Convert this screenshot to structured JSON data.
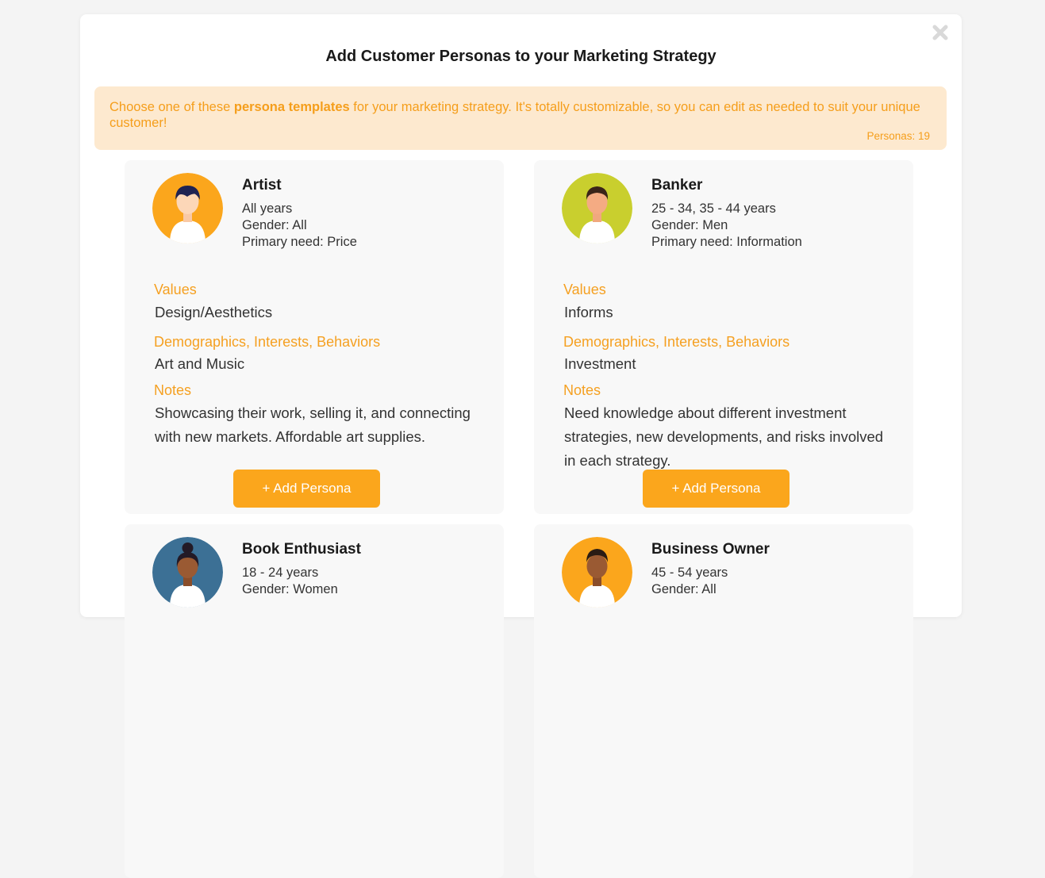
{
  "modal": {
    "title": "Add Customer Personas to your Marketing Strategy",
    "close_icon": "close-icon"
  },
  "notice": {
    "text_before": "Choose one of these ",
    "text_bold": "persona templates",
    "text_after": " for your marketing strategy. It's totally customizable, so you can edit as needed to suit your unique customer!",
    "count_label": "Personas: 19"
  },
  "labels": {
    "values": "Values",
    "demographics": "Demographics, Interests, Behaviors",
    "notes": "Notes",
    "add_button": "+ Add Persona"
  },
  "colors": {
    "accent": "#fba61c",
    "notice_bg": "#fde9cf",
    "avatar_artist": "#fba61c",
    "avatar_banker": "#c9cf2e",
    "avatar_book": "#3c7095",
    "avatar_business": "#fba61c"
  },
  "personas": [
    {
      "name": "Artist",
      "age": "All years",
      "gender": "Gender: All",
      "need": "Primary need: Price",
      "values": "Design/Aesthetics",
      "demographics": "Art and Music",
      "notes": "Showcasing their work, selling it, and connecting with new markets. Affordable art supplies.",
      "icon": "artist-avatar-icon"
    },
    {
      "name": "Banker",
      "age": "25 - 34, 35 - 44 years",
      "gender": "Gender: Men",
      "need": "Primary need: Information",
      "values": "Informs",
      "demographics": "Investment",
      "notes": "Need knowledge about different investment strategies, new developments, and risks involved in each strategy.",
      "icon": "banker-avatar-icon"
    },
    {
      "name": "Book Enthusiast",
      "age": "18 - 24 years",
      "gender": "Gender: Women",
      "icon": "book-enthusiast-avatar-icon"
    },
    {
      "name": "Business Owner",
      "age": "45 - 54 years",
      "gender": "Gender: All",
      "icon": "business-owner-avatar-icon"
    }
  ]
}
